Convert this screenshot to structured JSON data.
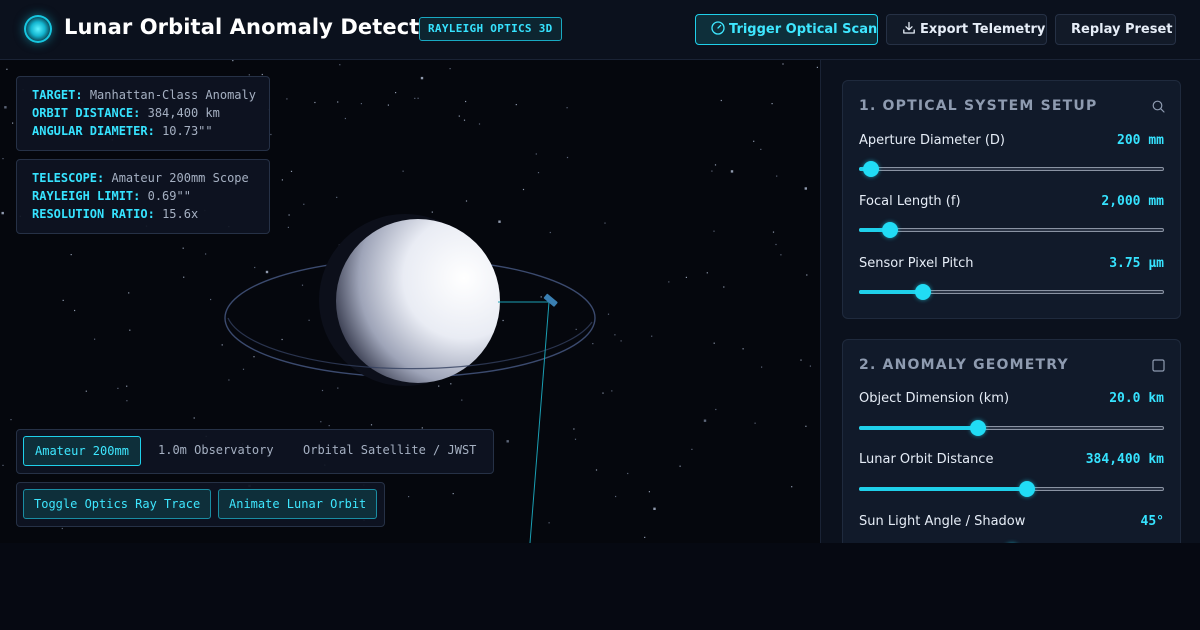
{
  "app": {
    "title": "Lunar Orbital Anomaly Detector",
    "badge": "RAYLEIGH OPTICS 3D",
    "accent_color": "#1fd0ea",
    "logo_icon": "glowing-orb-logo"
  },
  "toolbar": {
    "trigger_label": "Trigger Optical Scan",
    "trigger_icon": "gauge-icon",
    "export_label": "Export Telemetry",
    "export_icon": "download-icon",
    "replay_label": "Replay Preset"
  },
  "target_info": {
    "target_key": "TARGET:",
    "target_val": "Manhattan-Class Anomaly",
    "orbit_key": "ORBIT DISTANCE:",
    "orbit_val": "384,400 km",
    "angular_key": "ANGULAR DIAMETER:",
    "angular_val": "10.73\"\""
  },
  "telescope_info": {
    "telescope_key": "TELESCOPE:",
    "telescope_val": "Amateur 200mm Scope",
    "rayleigh_key": "RAYLEIGH LIMIT:",
    "rayleigh_val": "0.69\"\"",
    "ratio_key": "RESOLUTION RATIO:",
    "ratio_val": "15.6x"
  },
  "scope_tabs": {
    "items": [
      {
        "label": "Amateur 200mm",
        "active": true
      },
      {
        "label": "1.0m Observatory",
        "active": false
      },
      {
        "label": "Orbital Satellite / JWST",
        "active": false
      }
    ]
  },
  "actions": {
    "toggle_label": "Toggle Optics Ray Trace",
    "animate_label": "Animate Lunar Orbit"
  },
  "optical_setup": {
    "title": "1. OPTICAL SYSTEM SETUP",
    "icon": "search-icon",
    "controls": [
      {
        "label": "Aperture Diameter (D)",
        "value": "200 mm",
        "level": 0.04
      },
      {
        "label": "Focal Length (f)",
        "value": "2,000 mm",
        "level": 0.1
      },
      {
        "label": "Sensor Pixel Pitch",
        "value": "3.75 µm",
        "level": 0.21
      }
    ]
  },
  "anomaly_geometry": {
    "title": "2. ANOMALY GEOMETRY",
    "icon": "square-icon",
    "controls": [
      {
        "label": "Object Dimension (km)",
        "value": "20.0 km",
        "level": 0.39
      },
      {
        "label": "Lunar Orbit Distance",
        "value": "384,400 km",
        "level": 0.55
      },
      {
        "label": "Sun Light Angle / Shadow",
        "value": "45°",
        "level": 0.5
      }
    ]
  }
}
